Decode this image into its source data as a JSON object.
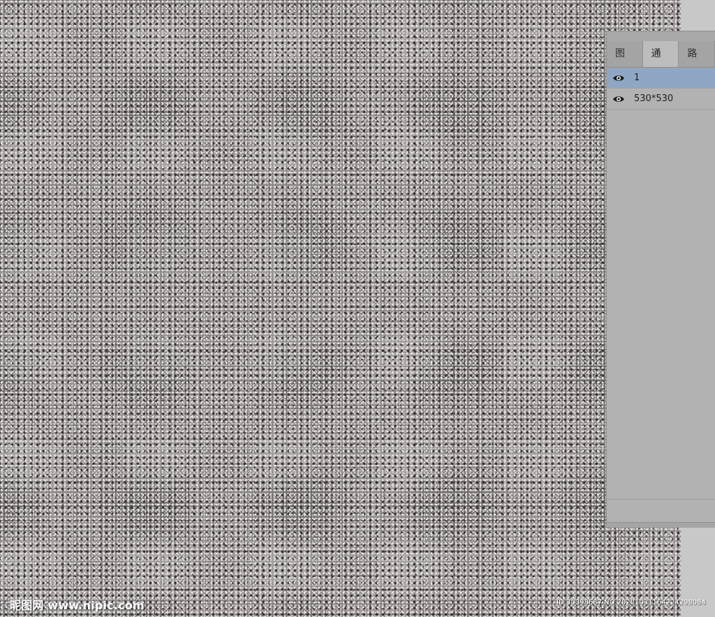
{
  "panel": {
    "tabs": [
      {
        "label": "图层",
        "active": false
      },
      {
        "label": "通道",
        "active": true
      },
      {
        "label": "路径",
        "active": false
      }
    ],
    "channels": [
      {
        "name": "1",
        "visible": true,
        "selected": true
      },
      {
        "name": "530*530",
        "visible": true,
        "selected": false
      }
    ]
  },
  "watermark": {
    "left": "昵图网 www.nipic.com",
    "right": "ID:30398687 NO:20201031164224298084"
  },
  "colors": {
    "selection": "#8fa7c4",
    "panel_bg": "#b2b2b2"
  },
  "icons": {
    "visibility": "eye-icon"
  }
}
